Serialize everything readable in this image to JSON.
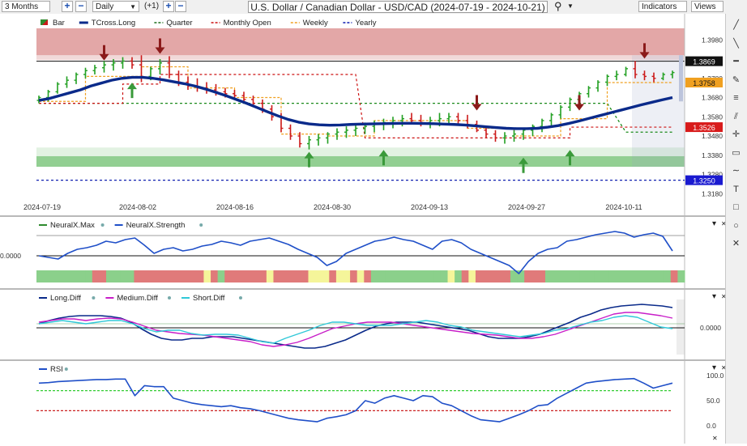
{
  "toolbar": {
    "period": "3 Months",
    "interval": "Daily",
    "offset": "(+1)",
    "title": "U.S. Dollar / Canadian Dollar - USD/CAD (2024-07-19 - 2024-10-21)",
    "indicators_label": "Indicators",
    "views_label": "Views"
  },
  "main_legend": [
    {
      "label": "Bar",
      "color": "#2e8b2e"
    },
    {
      "label": "TCross.Long",
      "color": "#0a2a8a"
    },
    {
      "label": "Quarter",
      "color": "#1a6e1a"
    },
    {
      "label": "Monthly Open",
      "color": "#cc1111"
    },
    {
      "label": "Weekly",
      "color": "#f0a020"
    },
    {
      "label": "Yearly",
      "color": "#0a1ab0"
    }
  ],
  "price_labels": {
    "high_marker": "1.3869",
    "weekly": "1.3758",
    "monthly": "1.3526",
    "yearly": "1.3250"
  },
  "price_ticks": [
    "1.3980",
    "1.3780",
    "1.3680",
    "1.3580",
    "1.3480",
    "1.3380",
    "1.3280",
    "1.3180"
  ],
  "date_ticks": [
    "2024-07-19",
    "2024-08-02",
    "2024-08-16",
    "2024-08-30",
    "2024-09-13",
    "2024-09-27",
    "2024-10-11"
  ],
  "neuralx": {
    "legend": [
      {
        "label": "NeuralX.Max",
        "color": "#2e8b2e"
      },
      {
        "label": "NeuralX.Strength",
        "color": "#1f4fc8"
      }
    ],
    "axis_label": "0.0000"
  },
  "diff": {
    "legend": [
      {
        "label": "Long.Diff",
        "color": "#0a2a8a"
      },
      {
        "label": "Medium.Diff",
        "color": "#c81ec8"
      },
      {
        "label": "Short.Diff",
        "color": "#30c8d8"
      }
    ],
    "axis_label": "0.0000"
  },
  "rsi": {
    "legend": [
      {
        "label": "RSI",
        "color": "#1f4fc8"
      }
    ],
    "axis_labels": [
      "100.0",
      "50.0",
      "0.0"
    ]
  },
  "sidebar_tools": [
    "line-tool-icon",
    "diagonal-line-icon",
    "horizontal-line-icon",
    "pencil-icon",
    "fibonacci-icon",
    "parallel-channel-icon",
    "crosshair-icon",
    "note-icon",
    "curve-icon",
    "text-icon",
    "rectangle-icon",
    "circle-icon",
    "delete-icon"
  ],
  "chart_data": {
    "type": "bar",
    "x_range": [
      "2024-07-19",
      "2024-10-21"
    ],
    "ylim": [
      1.316,
      1.404
    ],
    "ohlc_approx": [
      [
        1.3665,
        1.369,
        1.365,
        1.368
      ],
      [
        1.368,
        1.372,
        1.366,
        1.371
      ],
      [
        1.371,
        1.376,
        1.37,
        1.375
      ],
      [
        1.375,
        1.379,
        1.373,
        1.377
      ],
      [
        1.377,
        1.381,
        1.375,
        1.38
      ],
      [
        1.38,
        1.3835,
        1.378,
        1.382
      ],
      [
        1.382,
        1.385,
        1.38,
        1.3835
      ],
      [
        1.3835,
        1.387,
        1.381,
        1.385
      ],
      [
        1.385,
        1.388,
        1.382,
        1.386
      ],
      [
        1.386,
        1.389,
        1.383,
        1.387
      ],
      [
        1.387,
        1.389,
        1.383,
        1.385
      ],
      [
        1.385,
        1.39,
        1.376,
        1.379
      ],
      [
        1.379,
        1.384,
        1.377,
        1.383
      ],
      [
        1.383,
        1.388,
        1.38,
        1.386
      ],
      [
        1.386,
        1.3895,
        1.378,
        1.38
      ],
      [
        1.38,
        1.382,
        1.374,
        1.376
      ],
      [
        1.376,
        1.379,
        1.372,
        1.374
      ],
      [
        1.374,
        1.378,
        1.371,
        1.373
      ],
      [
        1.373,
        1.376,
        1.37,
        1.372
      ],
      [
        1.372,
        1.375,
        1.369,
        1.371
      ],
      [
        1.371,
        1.373,
        1.368,
        1.37
      ],
      [
        1.37,
        1.372,
        1.367,
        1.369
      ],
      [
        1.369,
        1.371,
        1.365,
        1.367
      ],
      [
        1.367,
        1.369,
        1.363,
        1.365
      ],
      [
        1.365,
        1.367,
        1.36,
        1.362
      ],
      [
        1.362,
        1.364,
        1.356,
        1.358
      ],
      [
        1.358,
        1.36,
        1.35,
        1.352
      ],
      [
        1.352,
        1.354,
        1.346,
        1.348
      ],
      [
        1.348,
        1.35,
        1.342,
        1.344
      ],
      [
        1.344,
        1.348,
        1.341,
        1.346
      ],
      [
        1.346,
        1.349,
        1.343,
        1.347
      ],
      [
        1.347,
        1.35,
        1.344,
        1.349
      ],
      [
        1.349,
        1.352,
        1.346,
        1.35
      ],
      [
        1.35,
        1.353,
        1.347,
        1.351
      ],
      [
        1.351,
        1.354,
        1.348,
        1.352
      ],
      [
        1.352,
        1.355,
        1.349,
        1.353
      ],
      [
        1.353,
        1.356,
        1.35,
        1.354
      ],
      [
        1.354,
        1.357,
        1.351,
        1.355
      ],
      [
        1.355,
        1.358,
        1.352,
        1.356
      ],
      [
        1.356,
        1.359,
        1.353,
        1.357
      ],
      [
        1.357,
        1.36,
        1.354,
        1.356
      ],
      [
        1.356,
        1.359,
        1.353,
        1.355
      ],
      [
        1.355,
        1.358,
        1.352,
        1.356
      ],
      [
        1.356,
        1.36,
        1.353,
        1.357
      ],
      [
        1.357,
        1.36,
        1.354,
        1.358
      ],
      [
        1.358,
        1.36,
        1.354,
        1.356
      ],
      [
        1.356,
        1.359,
        1.352,
        1.354
      ],
      [
        1.354,
        1.356,
        1.35,
        1.351
      ],
      [
        1.351,
        1.353,
        1.347,
        1.349
      ],
      [
        1.349,
        1.351,
        1.345,
        1.347
      ],
      [
        1.347,
        1.35,
        1.344,
        1.348
      ],
      [
        1.348,
        1.351,
        1.345,
        1.349
      ],
      [
        1.349,
        1.352,
        1.346,
        1.351
      ],
      [
        1.351,
        1.354,
        1.348,
        1.353
      ],
      [
        1.353,
        1.357,
        1.35,
        1.356
      ],
      [
        1.356,
        1.36,
        1.353,
        1.359
      ],
      [
        1.359,
        1.364,
        1.357,
        1.363
      ],
      [
        1.363,
        1.368,
        1.361,
        1.367
      ],
      [
        1.367,
        1.371,
        1.365,
        1.37
      ],
      [
        1.37,
        1.374,
        1.368,
        1.373
      ],
      [
        1.373,
        1.377,
        1.371,
        1.376
      ],
      [
        1.376,
        1.38,
        1.374,
        1.379
      ],
      [
        1.379,
        1.382,
        1.377,
        1.38
      ],
      [
        1.38,
        1.384,
        1.379,
        1.383
      ],
      [
        1.383,
        1.387,
        1.378,
        1.38
      ],
      [
        1.38,
        1.382,
        1.377,
        1.379
      ],
      [
        1.379,
        1.381,
        1.376,
        1.378
      ],
      [
        1.378,
        1.381,
        1.377,
        1.38
      ],
      [
        1.38,
        1.382,
        1.378,
        1.381
      ]
    ],
    "tcross_long": [
      1.3665,
      1.3675,
      1.369,
      1.3705,
      1.372,
      1.374,
      1.3755,
      1.377,
      1.378,
      1.3785,
      1.3785,
      1.378,
      1.3772,
      1.3762,
      1.3752,
      1.374,
      1.3725,
      1.3708,
      1.369,
      1.367,
      1.365,
      1.3628,
      1.3606,
      1.3585,
      1.3566,
      1.3552,
      1.3543,
      1.3538,
      1.3536,
      1.3537,
      1.354,
      1.3542,
      1.3543,
      1.3544,
      1.3545,
      1.3546,
      1.3546,
      1.3545,
      1.3544,
      1.3542,
      1.354,
      1.3537,
      1.3533,
      1.3528,
      1.3524,
      1.352,
      1.3518,
      1.3518,
      1.352,
      1.3526,
      1.3534,
      1.3545,
      1.3558,
      1.3572,
      1.3586,
      1.36,
      1.3614,
      1.3628,
      1.3642,
      1.3655,
      1.3668,
      1.368
    ],
    "levels": {
      "high_marker": 1.3869,
      "weekly": 1.3758,
      "monthly": 1.3526,
      "yearly": 1.325
    },
    "series": [
      {
        "name": "NeuralX.Strength",
        "panel": "neuralx"
      },
      {
        "name": "Long.Diff",
        "panel": "diff"
      },
      {
        "name": "Medium.Diff",
        "panel": "diff"
      },
      {
        "name": "Short.Diff",
        "panel": "diff"
      },
      {
        "name": "RSI",
        "panel": "rsi",
        "ylim": [
          0,
          100
        ],
        "values": [
          85,
          86,
          88,
          89,
          90,
          91,
          92,
          92,
          93,
          93,
          60,
          80,
          78,
          78,
          55,
          50,
          45,
          42,
          40,
          38,
          40,
          36,
          34,
          30,
          25,
          20,
          15,
          12,
          10,
          8,
          15,
          18,
          22,
          30,
          50,
          45,
          55,
          60,
          55,
          50,
          60,
          58,
          45,
          40,
          30,
          20,
          12,
          10,
          8,
          15,
          22,
          30,
          40,
          42,
          55,
          65,
          75,
          85,
          88,
          90,
          92,
          93,
          94,
          85,
          75,
          80,
          85
        ]
      }
    ]
  }
}
